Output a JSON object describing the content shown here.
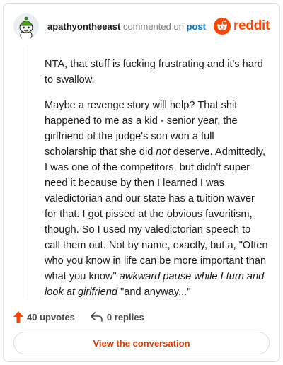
{
  "header": {
    "username": "apathyontheeast",
    "action_text": "commented on",
    "post_link": "post",
    "brand_name": "reddit",
    "brand_color": "#ff4500",
    "avatar_icon": "snoo-avatar-icon"
  },
  "comment": {
    "p1": "NTA, that stuff is fucking frustrating and it's hard to swallow.",
    "p2_a": "Maybe a revenge story will help? That shit happened to me as a kid - senior year, the girlfriend of the judge's son won a full scholarship that she did ",
    "p2_em1": "not",
    "p2_b": " deserve. Admittedly, I was one of the competitors, but didn't super need it because by then I learned I was valedictorian and our state has a tuition waver for that. I got pissed at the obvious favoritism, though. So I used my valedictorian speech to call them out. Not by name, exactly, but a, \"Often who you know in life can be more important than what you know\" ",
    "p2_em2": "awkward pause while I turn and look at girlfriend",
    "p2_c": " \"and anyway...\""
  },
  "footer": {
    "upvotes": "40 upvotes",
    "replies": "0 replies",
    "upvote_icon": "upvote-arrow-icon",
    "reply_icon": "reply-arrow-icon",
    "accent_color": "#ff4500"
  },
  "cta": {
    "label": "View the conversation",
    "color": "#d93a00"
  }
}
